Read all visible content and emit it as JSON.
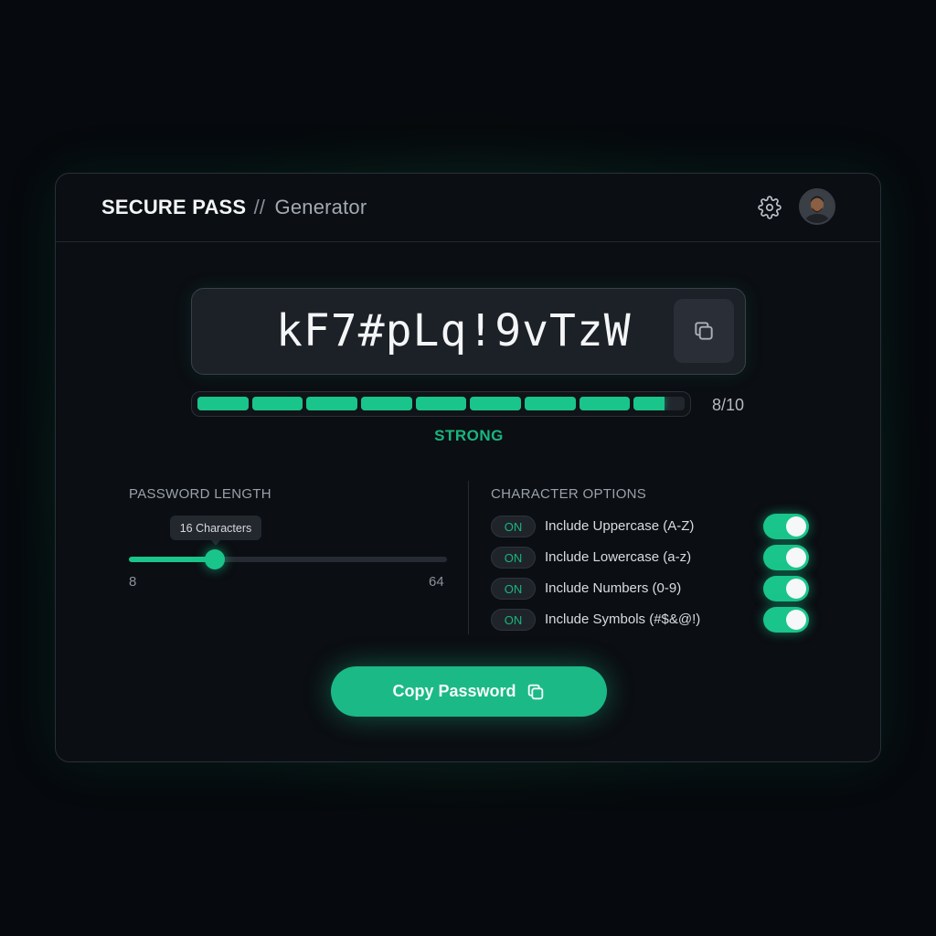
{
  "header": {
    "brand": "SECURE PASS",
    "separator": "//",
    "subtitle": "Generator",
    "icons": [
      "gear-icon",
      "avatar"
    ]
  },
  "password": {
    "value": "kF7#pLq!9vTzW",
    "copy_icon": "copy-icon"
  },
  "strength": {
    "score_text": "8/10",
    "score": 8.6,
    "segments": 9,
    "label": "STRONG",
    "color": "#19c58a"
  },
  "length": {
    "section_label": "PASSWORD LENGTH",
    "tooltip": "16 Characters",
    "value": 16,
    "min_label": "8",
    "max_label": "64",
    "min": 8,
    "max": 64
  },
  "options": {
    "section_label": "CHARACTER OPTIONS",
    "items": [
      {
        "badge": "ON",
        "label": "Include Uppercase (A-Z)",
        "enabled": true
      },
      {
        "badge": "ON",
        "label": "Include Lowercase (a-z)",
        "enabled": true
      },
      {
        "badge": "ON",
        "label": "Include Numbers (0-9)",
        "enabled": true
      },
      {
        "badge": "ON",
        "label": "Include Symbols (#$&@!)",
        "enabled": true
      }
    ]
  },
  "actions": {
    "copy_label": "Copy Password"
  },
  "colors": {
    "accent": "#19c58a",
    "card_bg": "#0b0e13",
    "page_bg": "#06090d"
  }
}
